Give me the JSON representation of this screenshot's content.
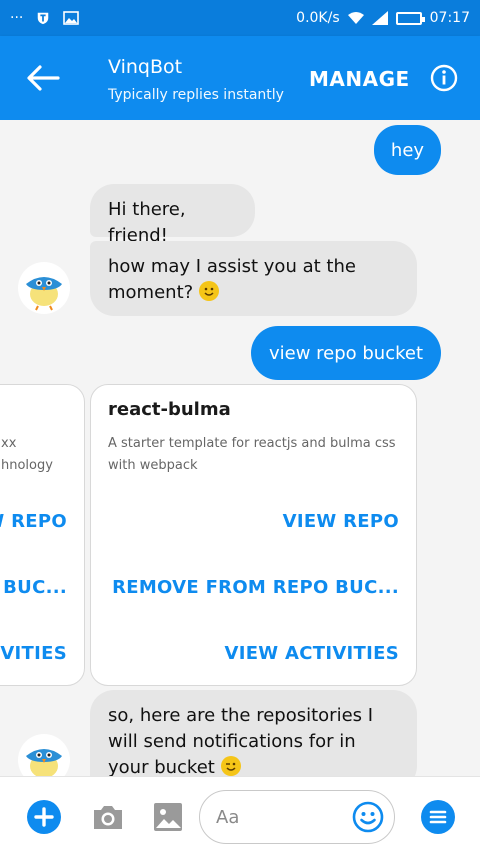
{
  "status_bar": {
    "dots": "···",
    "speed": "0.0K/s",
    "time": "07:17"
  },
  "app_bar": {
    "title": "VinqBot",
    "subtitle": "Typically replies instantly",
    "manage_label": "MANAGE"
  },
  "messages": {
    "out_1": "hey",
    "in_1": "Hi there, friend!",
    "in_2": "how may I assist you at the moment?",
    "out_2": "view repo bucket",
    "in_3": "so, here are the repositories I will send notifications for in your bucket"
  },
  "cards": [
    {
      "title": "",
      "desc_line1": "xx",
      "desc_line2": "hnology",
      "btn_view_repo": "W REPO",
      "btn_remove": ") BUC...",
      "btn_activities": "IVITIES"
    },
    {
      "title": "react-bulma",
      "description": " A starter template for reactjs and bulma css with webpack",
      "btn_view_repo": "VIEW REPO",
      "btn_remove": "REMOVE FROM REPO BUC...",
      "btn_activities": "VIEW ACTIVITIES"
    }
  ],
  "composer": {
    "placeholder": "Aa"
  },
  "colors": {
    "accent": "#0e8bef",
    "status_bar": "#0a7ddc",
    "incoming_bubble": "#e6e6e6",
    "background": "#f4f4f4"
  },
  "icons": [
    "back-arrow-icon",
    "info-icon",
    "plus-icon",
    "camera-icon",
    "image-icon",
    "smile-icon",
    "menu-icon",
    "wifi-icon",
    "signal-icon",
    "battery-icon"
  ]
}
